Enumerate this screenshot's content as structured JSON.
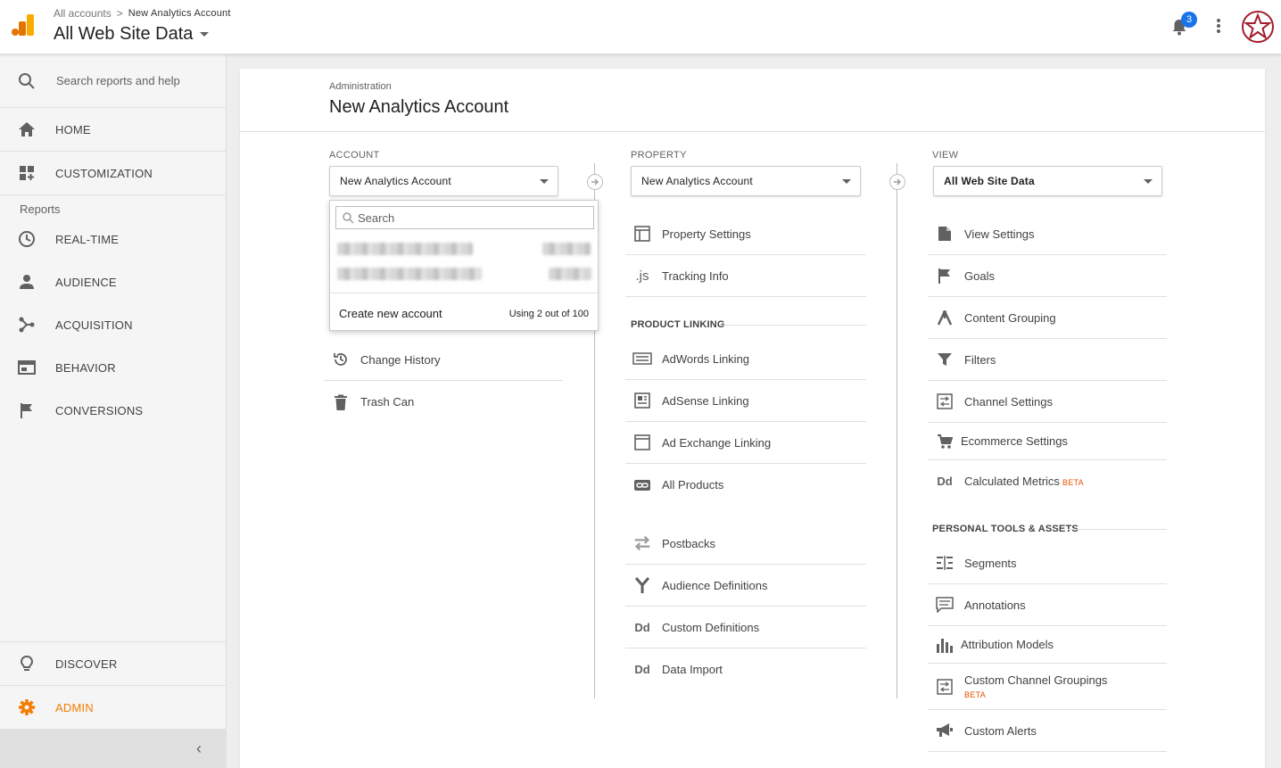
{
  "header": {
    "breadcrumb_root": "All accounts",
    "breadcrumb_sep": ">",
    "breadcrumb_current": "New Analytics Account",
    "view_title": "All Web Site Data",
    "notification_count": "3"
  },
  "sidebar": {
    "search_placeholder": "Search reports and help",
    "home": "HOME",
    "customization": "CUSTOMIZATION",
    "reports_label": "Reports",
    "realtime": "REAL-TIME",
    "audience": "AUDIENCE",
    "acquisition": "ACQUISITION",
    "behavior": "BEHAVIOR",
    "conversions": "CONVERSIONS",
    "discover": "DISCOVER",
    "admin": "ADMIN",
    "collapse": "‹"
  },
  "main": {
    "admin_label": "Administration",
    "title": "New Analytics Account",
    "account": {
      "label": "ACCOUNT",
      "selected": "New Analytics Account",
      "items": [
        {
          "label": "Change History"
        },
        {
          "label": "Trash Can"
        }
      ]
    },
    "account_dropdown": {
      "search_placeholder": "Search",
      "create": "Create new account",
      "usage": "Using 2 out of 100"
    },
    "property": {
      "label": "PROPERTY",
      "selected": "New Analytics Account",
      "items": [
        {
          "label": "Property Settings"
        },
        {
          "label": "Tracking Info"
        }
      ],
      "product_linking_label": "PRODUCT LINKING",
      "linking": [
        {
          "label": "AdWords Linking"
        },
        {
          "label": "AdSense Linking"
        },
        {
          "label": "Ad Exchange Linking"
        },
        {
          "label": "All Products"
        }
      ],
      "more": [
        {
          "label": "Postbacks"
        },
        {
          "label": "Audience Definitions"
        },
        {
          "label": "Custom Definitions"
        },
        {
          "label": "Data Import"
        }
      ]
    },
    "view": {
      "label": "VIEW",
      "selected": "All Web Site Data",
      "items": [
        {
          "label": "View Settings"
        },
        {
          "label": "Goals"
        },
        {
          "label": "Content Grouping"
        },
        {
          "label": "Filters"
        },
        {
          "label": "Channel Settings"
        },
        {
          "label": "Ecommerce Settings"
        },
        {
          "label": "Calculated Metrics",
          "badge": "BETA"
        }
      ],
      "personal_label": "PERSONAL TOOLS & ASSETS",
      "personal": [
        {
          "label": "Segments"
        },
        {
          "label": "Annotations"
        },
        {
          "label": "Attribution Models"
        },
        {
          "label": "Custom Channel Groupings",
          "badge": "BETA"
        },
        {
          "label": "Custom Alerts"
        }
      ]
    }
  },
  "colors": {
    "accent_orange": "#f57c00",
    "badge_blue": "#1a73e8",
    "avatar_red": "#a31d2c"
  }
}
